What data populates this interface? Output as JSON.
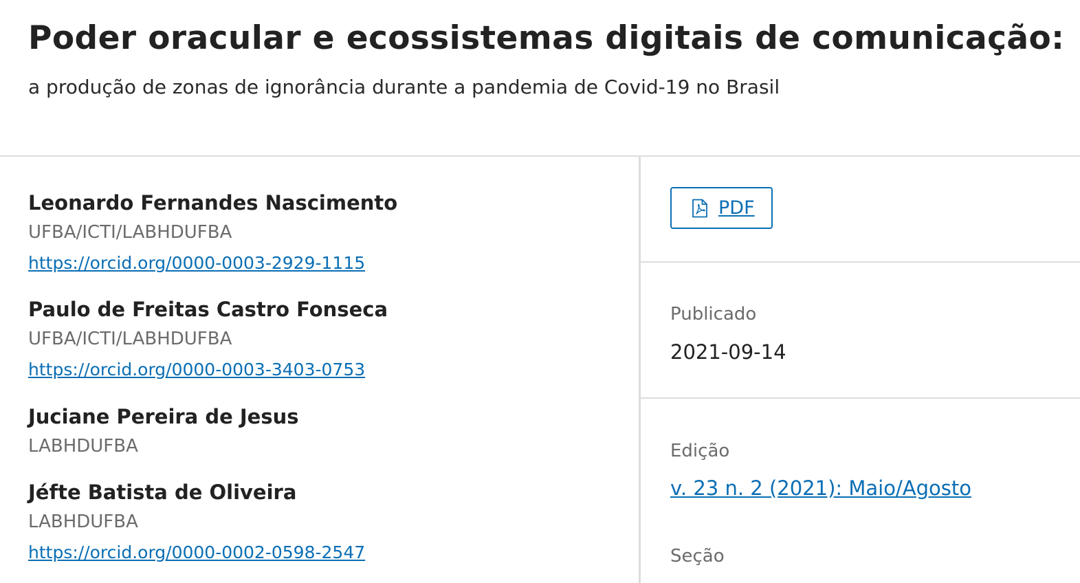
{
  "article": {
    "title": "Poder oracular e ecossistemas digitais de comunicação:",
    "subtitle": "a produção de zonas de ignorância durante a pandemia de Covid-19 no Brasil"
  },
  "authors": [
    {
      "name": "Leonardo Fernandes Nascimento",
      "affiliation": "UFBA/ICTI/LABHDUFBA",
      "orcid": "https://orcid.org/0000-0003-2929-1115"
    },
    {
      "name": "Paulo de Freitas Castro Fonseca",
      "affiliation": "UFBA/ICTI/LABHDUFBA",
      "orcid": "https://orcid.org/0000-0003-3403-0753"
    },
    {
      "name": "Juciane Pereira de Jesus",
      "affiliation": "LABHDUFBA"
    },
    {
      "name": "Jéfte Batista de Oliveira",
      "affiliation": "LABHDUFBA",
      "orcid": "https://orcid.org/0000-0002-0598-2547"
    }
  ],
  "sidebar": {
    "pdf_label": "PDF",
    "pdf_icon": "pdf-file-icon",
    "published_label": "Publicado",
    "published_value": "2021-09-14",
    "issue_label": "Edição",
    "issue_link": "v. 23 n. 2 (2021): Maio/Agosto",
    "section_label": "Seção"
  },
  "colors": {
    "link": "#0a6eb4",
    "divider": "#dddddd",
    "muted_text": "#6b6b6b"
  }
}
